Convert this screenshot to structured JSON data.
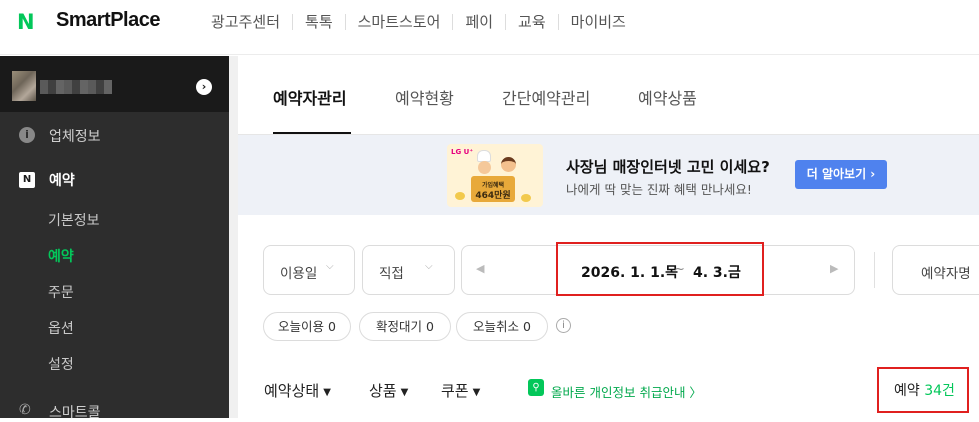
{
  "topbar": {
    "logo_mark": "N",
    "logo_text": "SmartPlace",
    "nav": [
      "광고주센터",
      "톡톡",
      "스마트스토어",
      "페이",
      "교육",
      "마이비즈"
    ]
  },
  "sidebar": {
    "items": [
      {
        "label": "업체정보",
        "icon": "info-icon"
      },
      {
        "label": "예약",
        "icon": "calendar-icon"
      }
    ],
    "subitems": [
      "기본정보",
      "예약",
      "주문",
      "옵션",
      "설정"
    ],
    "active_subitem": "예약",
    "bottom_item": "스마트콜"
  },
  "tabs": [
    "예약자관리",
    "예약현황",
    "간단예약관리",
    "예약상품"
  ],
  "banner": {
    "brand": "LG U⁺",
    "img_line1": "가입혜택",
    "img_line2": "464만원",
    "title": "사장님 매장인터넷 고민 이세요?",
    "subtitle": "나에게 딱 맞는 진짜 혜택 만나세요!",
    "button": "더 알아보기 ›"
  },
  "filters": {
    "date_type": "이용일",
    "period": "직접",
    "start_date": "2026. 1. 1.목",
    "tilde": "~",
    "end_date": "4. 3.금",
    "search_field": "예약자명"
  },
  "chips": [
    "오늘이용 0",
    "확정대기 0",
    "오늘취소 0"
  ],
  "bottom": {
    "status": "예약상태",
    "product": "상품",
    "coupon": "쿠폰",
    "privacy": "올바른 개인정보 취급안내 〉",
    "count_label": "예약",
    "count_value": "34건"
  },
  "colors": {
    "accent": "#03c75a",
    "highlight": "#e0201f",
    "button": "#4f82ee",
    "sidebar": "#2d2d2d"
  }
}
